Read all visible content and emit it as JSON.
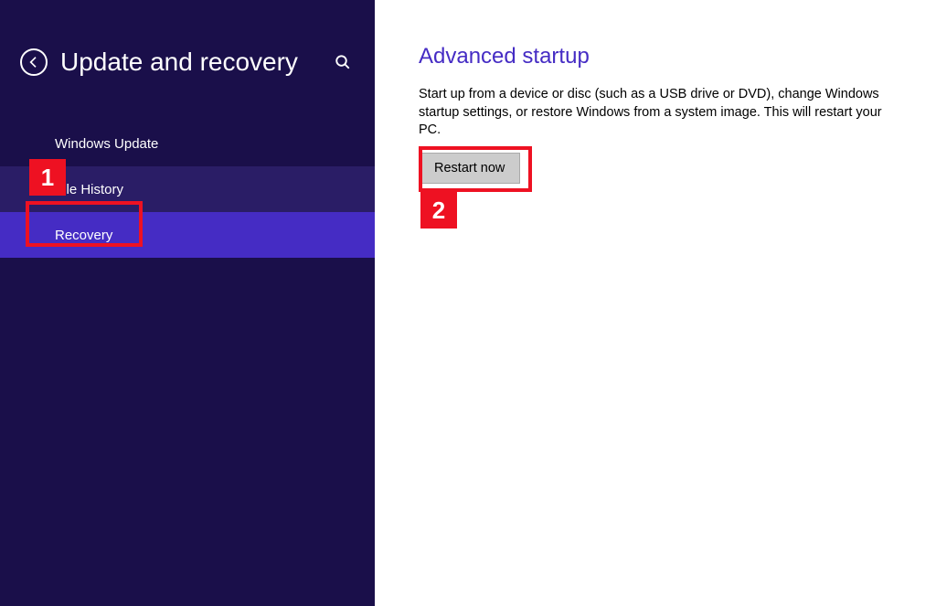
{
  "header": {
    "title": "Update and recovery"
  },
  "sidebar": {
    "items": [
      {
        "label": "Windows Update"
      },
      {
        "label": "File History"
      },
      {
        "label": "Recovery"
      }
    ]
  },
  "content": {
    "section_title": "Advanced startup",
    "section_desc": "Start up from a device or disc (such as a USB drive or DVD), change Windows startup settings, or restore Windows from a system image. This will restart your PC.",
    "restart_label": "Restart now"
  },
  "annotations": {
    "one": "1",
    "two": "2"
  }
}
